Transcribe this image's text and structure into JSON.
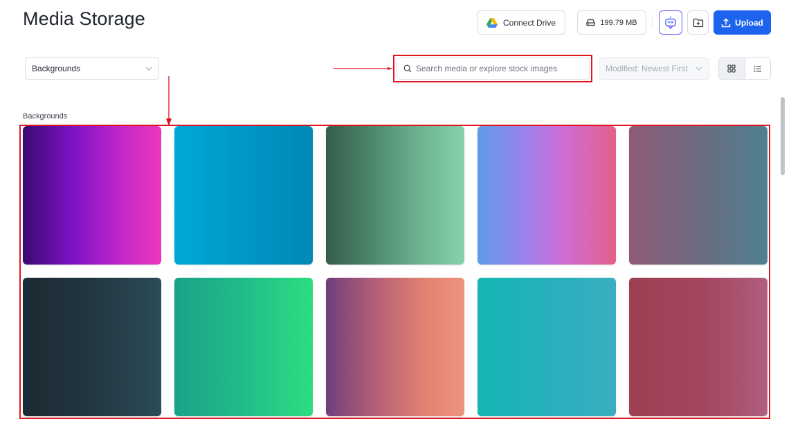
{
  "header": {
    "title": "Media Storage",
    "connect_drive_label": "Connect Drive",
    "storage_used": "199.79 MB",
    "upload_label": "Upload"
  },
  "toolbar": {
    "category_select_value": "Backgrounds",
    "search_placeholder": "Search media or explore stock images",
    "sort_select_value": "Modified: Newest First",
    "view_mode": "grid"
  },
  "section": {
    "label": "Backgrounds"
  },
  "tiles": [
    {
      "gradient": "linear-gradient(90deg, #3a0a6f 0%, #7b12c4 35%, #c126c9 70%, #ec37bb 100%)"
    },
    {
      "gradient": "linear-gradient(90deg, #00a9d6 0%, #0095c4 55%, #0089b5 100%)"
    },
    {
      "gradient": "linear-gradient(90deg, #355c4b 0%, #4e8a6e 35%, #6fb592 70%, #86d2ad 100%)"
    },
    {
      "gradient": "linear-gradient(90deg, #5e9ce8 0%, #9b82ea 35%, #cc6ed8 60%, #e2608a 100%)"
    },
    {
      "gradient": "linear-gradient(90deg, #8f5a76 0%, #6d6a80 50%, #4f8191 100%)"
    },
    {
      "gradient": "linear-gradient(90deg, #1b2a33 0%, #22363f 50%, #2a4b58 100%)"
    },
    {
      "gradient": "linear-gradient(90deg, #1aa386 0%, #20b98a 45%, #2dde7f 100%)"
    },
    {
      "gradient": "linear-gradient(90deg, #6f3e7c 0%, #b35f77 35%, #e08071 70%, #ee947c 100%)"
    },
    {
      "gradient": "linear-gradient(90deg, #15b6b3 0%, #26b0bb 50%, #3cadc0 100%)"
    },
    {
      "gradient": "linear-gradient(90deg, #9e3f52 0%, #a2475e 55%, #b15e80 100%)"
    }
  ],
  "colors": {
    "accent": "#1d63ed",
    "annotation": "#e0141e",
    "ai_border": "#6b5cf6"
  }
}
